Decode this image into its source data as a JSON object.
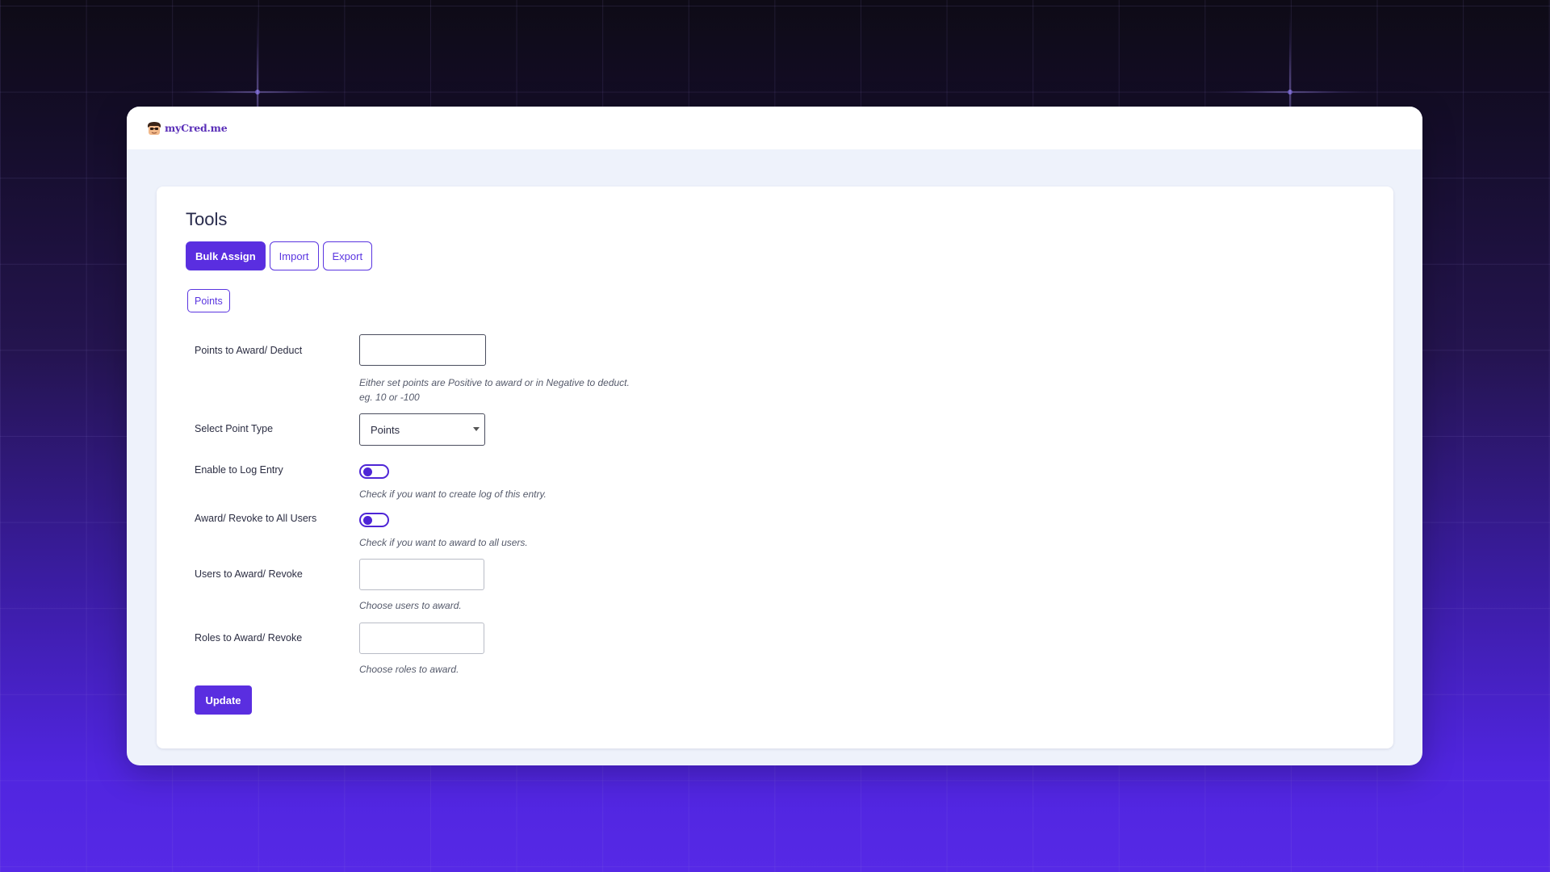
{
  "brand": {
    "name": "myCred.me"
  },
  "page": {
    "title": "Tools"
  },
  "tabs": [
    {
      "label": "Bulk Assign",
      "active": true
    },
    {
      "label": "Import",
      "active": false
    },
    {
      "label": "Export",
      "active": false
    }
  ],
  "subtab": {
    "label": "Points"
  },
  "form": {
    "points": {
      "label": "Points to Award/ Deduct",
      "value": "",
      "hint_line1": "Either set points are Positive to award or in Negative to deduct.",
      "hint_line2": "eg. 10 or -100"
    },
    "point_type": {
      "label": "Select Point Type",
      "selected": "Points"
    },
    "log_entry": {
      "label": "Enable to Log Entry",
      "enabled": false,
      "hint": "Check if you want to create log of this entry."
    },
    "all_users": {
      "label": "Award/ Revoke to All Users",
      "enabled": false,
      "hint": "Check if you want to award to all users."
    },
    "users": {
      "label": "Users to Award/ Revoke",
      "value": "",
      "hint": "Choose users to award."
    },
    "roles": {
      "label": "Roles to Award/ Revoke",
      "value": "",
      "hint": "Choose roles to award."
    },
    "submit_label": "Update"
  },
  "colors": {
    "accent": "#5a2ee0",
    "window_bg": "#eef2fb",
    "text": "#2b2d42"
  }
}
